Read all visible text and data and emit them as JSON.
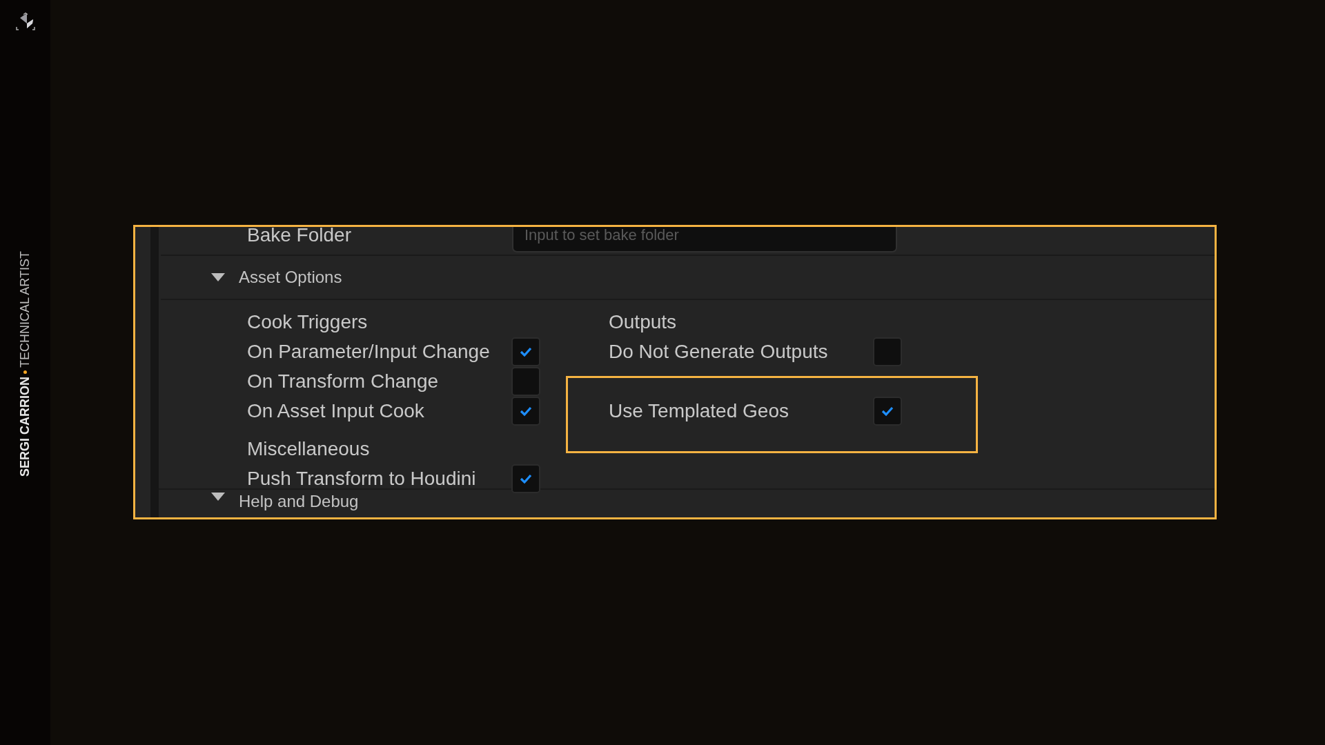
{
  "sidebar": {
    "name": "SERGI CARRION",
    "title": "TECHNICAL ARTIST"
  },
  "panel": {
    "cut_row": {
      "label": "Bake Folder",
      "placeholder": "Input to set bake folder"
    },
    "section": {
      "title": "Asset Options",
      "expanded": true
    },
    "columns": [
      {
        "groups": [
          {
            "heading": "Cook Triggers",
            "items": [
              {
                "label": "On Parameter/Input Change",
                "checked": true,
                "highlighted": false
              },
              {
                "label": "On Transform Change",
                "checked": false,
                "highlighted": false
              },
              {
                "label": "On Asset Input Cook",
                "checked": true,
                "highlighted": false
              }
            ]
          },
          {
            "heading": "Miscellaneous",
            "items": [
              {
                "label": "Push Transform to Houdini",
                "checked": true,
                "highlighted": false
              }
            ]
          }
        ]
      },
      {
        "groups": [
          {
            "heading": "Outputs",
            "items": [
              {
                "label": "Do Not Generate Outputs",
                "checked": false,
                "highlighted": false
              },
              {
                "label": "Use Templated Geos",
                "checked": true,
                "highlighted": true
              }
            ]
          }
        ]
      }
    ],
    "next_section": {
      "title": "Help and Debug",
      "expanded": true
    }
  }
}
